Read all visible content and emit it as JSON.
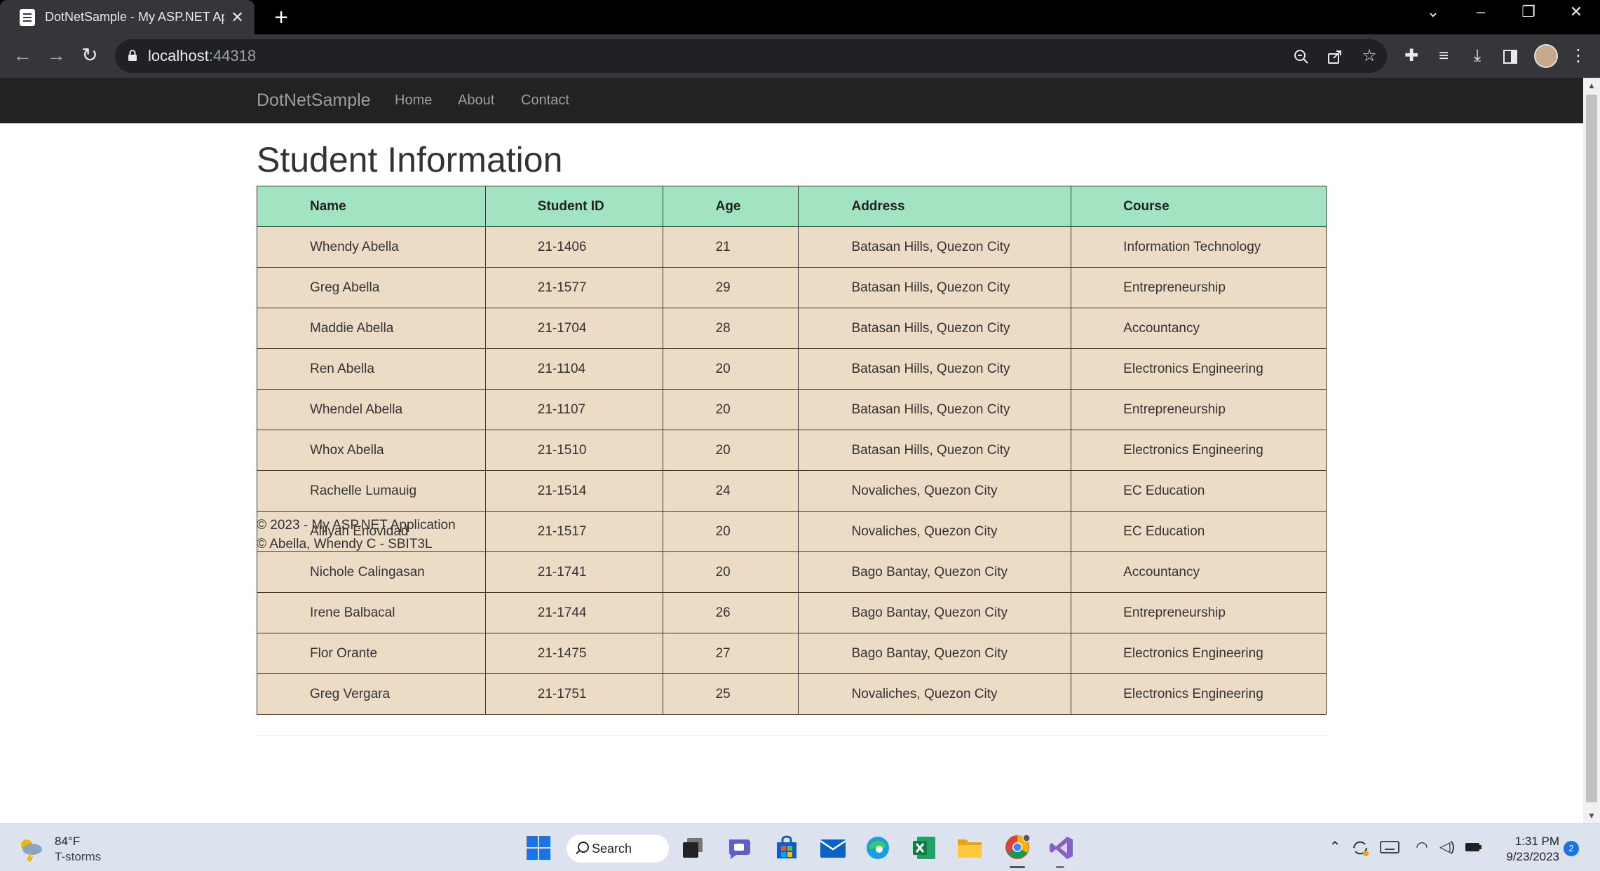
{
  "browser": {
    "tab_title": "DotNetSample - My ASP.NET Application",
    "tab_close": "✕",
    "new_tab": "+",
    "url_host": "localhost",
    "url_port": ":44318"
  },
  "navbar": {
    "brand": "DotNetSample",
    "links": [
      "Home",
      "About",
      "Contact"
    ]
  },
  "page": {
    "title": "Student Information",
    "columns": [
      "Name",
      "Student ID",
      "Age",
      "Address",
      "Course"
    ],
    "rows": [
      [
        "Whendy Abella",
        "21-1406",
        "21",
        "Batasan Hills, Quezon City",
        "Information Technology"
      ],
      [
        "Greg Abella",
        "21-1577",
        "29",
        "Batasan Hills, Quezon City",
        "Entrepreneurship"
      ],
      [
        "Maddie Abella",
        "21-1704",
        "28",
        "Batasan Hills, Quezon City",
        "Accountancy"
      ],
      [
        "Ren Abella",
        "21-1104",
        "20",
        "Batasan Hills, Quezon City",
        "Electronics Engineering"
      ],
      [
        "Whendel Abella",
        "21-1107",
        "20",
        "Batasan Hills, Quezon City",
        "Entrepreneurship"
      ],
      [
        "Whox Abella",
        "21-1510",
        "20",
        "Batasan Hills, Quezon City",
        "Electronics Engineering"
      ],
      [
        "Rachelle Lumauig",
        "21-1514",
        "24",
        "Novaliches, Quezon City",
        "EC Education"
      ],
      [
        "Alliyah Enovidad",
        "21-1517",
        "20",
        "Novaliches, Quezon City",
        "EC Education"
      ],
      [
        "Nichole Calingasan",
        "21-1741",
        "20",
        "Bago Bantay, Quezon City",
        "Accountancy"
      ],
      [
        "Irene Balbacal",
        "21-1744",
        "26",
        "Bago Bantay, Quezon City",
        "Entrepreneurship"
      ],
      [
        "Flor Orante",
        "21-1475",
        "27",
        "Bago Bantay, Quezon City",
        "Electronics Engineering"
      ],
      [
        "Greg Vergara",
        "21-1751",
        "25",
        "Novaliches, Quezon City",
        "Electronics Engineering"
      ]
    ],
    "footer": [
      "© 2023 - My ASP.NET Application",
      "© Abella, Whendy C - SBIT3L"
    ]
  },
  "taskbar": {
    "weather_temp": "84°F",
    "weather_cond": "T-storms",
    "search_label": "Search",
    "time": "1:31 PM",
    "date": "9/23/2023",
    "notification_count": "2"
  },
  "colors": {
    "header_row": "#a2e4c2",
    "body_row": "#ecdcc6",
    "navbar": "#222222"
  }
}
